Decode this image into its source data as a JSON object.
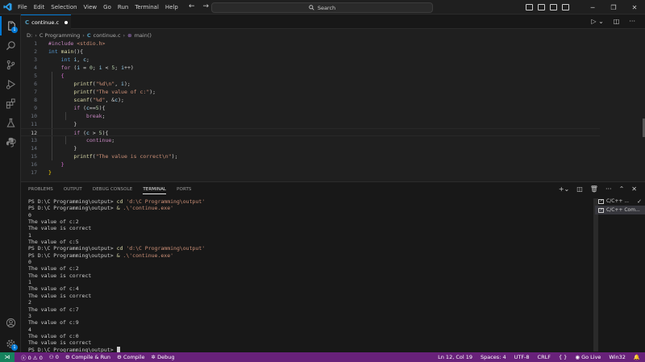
{
  "menu": [
    "File",
    "Edit",
    "Selection",
    "View",
    "Go",
    "Run",
    "Terminal",
    "Help"
  ],
  "search": {
    "label": "Search"
  },
  "tab": {
    "name": "continue.c"
  },
  "breadcrumb": {
    "drive": "D:",
    "folder": "C Programming",
    "file": "continue.c",
    "symbol": "main()"
  },
  "code_lines": [
    "#include <stdio.h>",
    "int main(){",
    "    int i, c;",
    "    for (i = 0; i < 5; i++)",
    "    {",
    "        printf(\"%d\\n\", i);",
    "        printf(\"The value of c:\");",
    "        scanf(\"%d\", &c);",
    "        if (c==5){",
    "            break;",
    "        }",
    "        if (c > 5){",
    "            continue;",
    "        }",
    "        printf(\"The value is correct\\n\");",
    "    }",
    "}"
  ],
  "line_numbers": [
    "1",
    "2",
    "3",
    "4",
    "5",
    "6",
    "7",
    "8",
    "9",
    "10",
    "11",
    "12",
    "13",
    "14",
    "15",
    "16",
    "17"
  ],
  "panel_tabs": [
    "PROBLEMS",
    "OUTPUT",
    "DEBUG CONSOLE",
    "TERMINAL",
    "PORTS"
  ],
  "terminal": {
    "prompt": "PS D:\\C Programming\\output> ",
    "cd_cmd": "cd",
    "cd_arg": "'d:\\C Programming\\output'",
    "run_cmd": "&",
    "run_arg": ".\\'continue.exe'",
    "run1_output": [
      "0",
      "The value of c:2",
      "The value is correct",
      "1",
      "The value of c:5"
    ],
    "run2_output": [
      "0",
      "The value of c:2",
      "The value is correct",
      "1",
      "The value of c:4",
      "The value is correct",
      "2",
      "The value of c:7",
      "3",
      "The value of c:9",
      "4",
      "The value of c:0",
      "The value is correct"
    ]
  },
  "terminal_list": [
    {
      "label": "C/C++ ...",
      "check": "✓"
    },
    {
      "label": "C/C++ Com..."
    }
  ],
  "statusbar": {
    "errors": "0",
    "warnings": "0",
    "ports": "0",
    "compile_run": "Compile & Run",
    "compile": "Compile",
    "debug": "Debug",
    "position": "Ln 12, Col 19",
    "spaces": "Spaces: 4",
    "encoding": "UTF-8",
    "eol": "CRLF",
    "language_icon": "{ }",
    "golive": "Go Live",
    "platform": "Win32"
  },
  "colors": {
    "accent": "#0078d4",
    "statusbar": "#68217a",
    "remote": "#16825d"
  }
}
